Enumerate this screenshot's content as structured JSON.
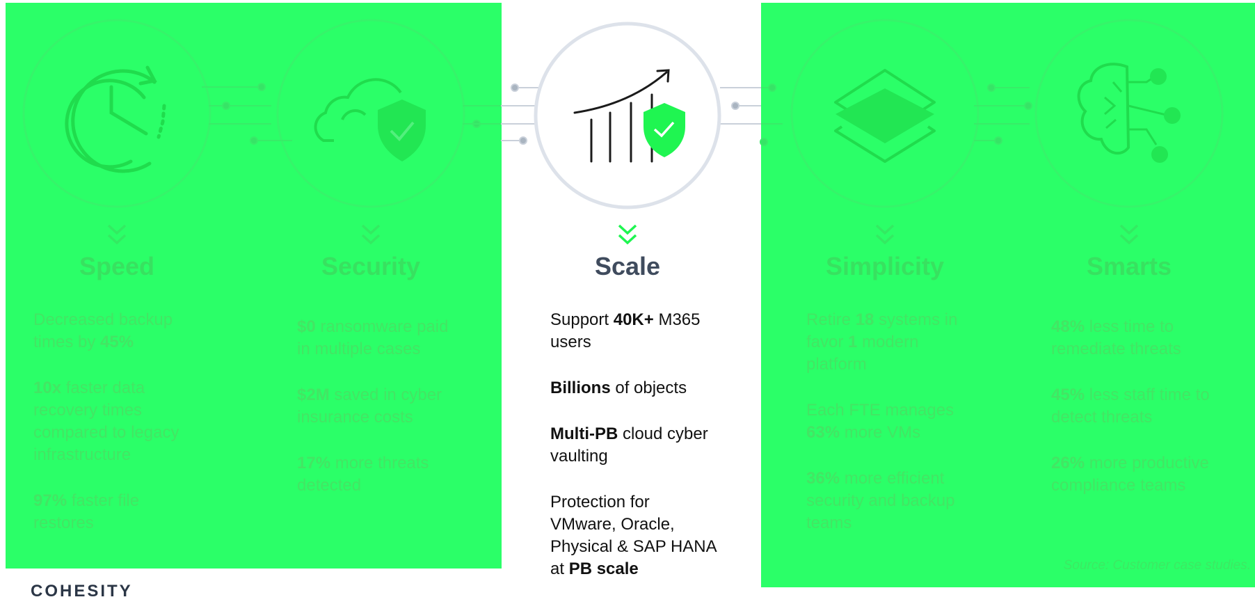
{
  "colors": {
    "panel_green": "#2bff68",
    "accent": "#19f04c",
    "heading": "#3f4b5d",
    "faded_text": "#43e564"
  },
  "cards": [
    {
      "heading": "Speed",
      "icon": "clock-refresh-icon",
      "stats": [
        {
          "pre": "Decreased backup times by ",
          "bold": "45%",
          "post": ""
        },
        {
          "pre": "",
          "bold": "10x",
          "post": " faster data recovery times compared to legacy infrastructure"
        },
        {
          "pre": "",
          "bold": "97%",
          "post": " faster file restores"
        }
      ]
    },
    {
      "heading": "Security",
      "icon": "cloud-shield-icon",
      "stats": [
        {
          "pre": "",
          "bold": "$0",
          "post": " ransomware paid in multiple cases"
        },
        {
          "pre": "",
          "bold": "$2M",
          "post": " saved in cyber insurance costs"
        },
        {
          "pre": "",
          "bold": "17%",
          "post": " more threats detected"
        }
      ]
    },
    {
      "heading": "Scale",
      "icon": "growth-chart-shield-icon",
      "stats": [
        {
          "pre": "Support ",
          "bold": "40K+",
          "post": " M365 users"
        },
        {
          "pre": "",
          "bold": "Billions",
          "post": " of objects"
        },
        {
          "pre": "",
          "bold": "Multi-PB",
          "post": " cloud cyber vaulting"
        },
        {
          "pre": "Protection for VMware, Oracle, Physical & SAP HANA at ",
          "bold": "PB scale",
          "post": ""
        }
      ]
    },
    {
      "heading": "Simplicity",
      "icon": "layers-icon",
      "stats": [
        {
          "pre": "Retire ",
          "bold": "18",
          "post": " systems in favor "
        },
        {
          "pre": "Each FTE manages ",
          "bold": "63%",
          "post": " more VMs"
        },
        {
          "pre": "",
          "bold": "36%",
          "post": " more efficient security and backup teams"
        }
      ]
    },
    {
      "heading": "Smarts",
      "icon": "brain-circuit-icon",
      "stats": [
        {
          "pre": "",
          "bold": "48%",
          "post": " less time to remediate threats"
        },
        {
          "pre": "",
          "bold": "45%",
          "post": " less staff time to detect threats"
        },
        {
          "pre": "",
          "bold": "26%",
          "post": " more productive compliance teams"
        }
      ]
    }
  ],
  "simplicity_first_bold2": "1",
  "simplicity_first_post2": " modern platform",
  "source_note": "Source: Customer case studies.",
  "logo_text": "COHESITY"
}
